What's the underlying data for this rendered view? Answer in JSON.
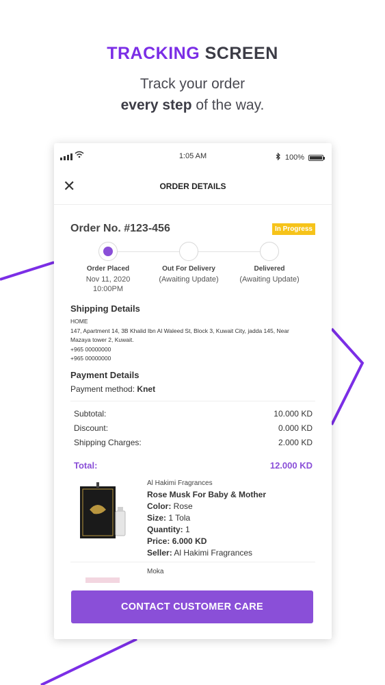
{
  "promo": {
    "title_accent": "TRACKING",
    "title_rest": "SCREEN",
    "sub_line1": "Track your order",
    "sub_bold": "every step",
    "sub_rest": "of the way."
  },
  "colors": {
    "accent": "#7b2ee6",
    "purple": "#8a4fd8",
    "badge": "#f6c31a"
  },
  "status_bar": {
    "time": "1:05 AM",
    "battery": "100%",
    "battery_level": 1.0
  },
  "navbar": {
    "title": "ORDER DETAILS",
    "close_icon": "close-icon"
  },
  "order": {
    "number": "Order No. #123-456",
    "status": "In Progress",
    "steps": [
      {
        "label": "Order Placed",
        "line1": "Nov 11, 2020",
        "line2": "10:00PM",
        "active": true
      },
      {
        "label": "Out For Delivery",
        "line1": "(Awaiting Update)",
        "line2": "",
        "active": false
      },
      {
        "label": "Delivered",
        "line1": "(Awaiting Update)",
        "line2": "",
        "active": false
      }
    ]
  },
  "shipping": {
    "title": "Shipping Details",
    "type": "HOME",
    "address1": "147, Apartment 14, 3B Khalid Ibn Al Waleed St, Block 3, Kuwait City, jadda 145, Near",
    "address2": "Mazaya tower 2, Kuwait.",
    "phone1": "+965 00000000",
    "phone2": "+965 00000000"
  },
  "payment": {
    "title": "Payment Details",
    "method_label": "Payment method:",
    "method_value": "Knet"
  },
  "summary": {
    "subtotal_label": "Subtotal:",
    "subtotal": "10.000 KD",
    "discount_label": "Discount:",
    "discount": "0.000 KD",
    "shipping_label": "Shipping Charges:",
    "shipping": "2.000 KD",
    "total_label": "Total:",
    "total": "12.000 KD"
  },
  "products": [
    {
      "brand": "Al Hakimi Fragrances",
      "name": "Rose Musk For Baby & Mother",
      "color_label": "Color:",
      "color": "Rose",
      "size_label": "Size:",
      "size": "1 Tola",
      "qty_label": "Quantity:",
      "qty": "1",
      "price_label": "Price:",
      "price": "6.000 KD",
      "seller_label": "Seller:",
      "seller": "Al Hakimi Fragrances"
    },
    {
      "brand": "Moka"
    }
  ],
  "cta": {
    "label": "CONTACT CUSTOMER CARE"
  }
}
